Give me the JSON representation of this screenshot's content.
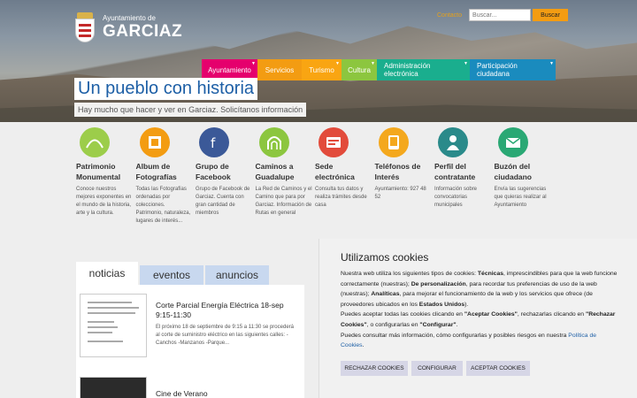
{
  "header": {
    "logo_small": "Ayuntamiento de",
    "logo_big": "GARCIAZ",
    "contact": "Contacto",
    "search_placeholder": "Buscar...",
    "search_button": "Buscar"
  },
  "nav": [
    {
      "label": "Ayuntamiento",
      "color": "#e5006d",
      "dropdown": true
    },
    {
      "label": "Servicios",
      "color": "#f39c12",
      "dropdown": false
    },
    {
      "label": "Turismo",
      "color": "#f9a512",
      "dropdown": true
    },
    {
      "label": "Cultura",
      "color": "#8cc63f",
      "dropdown": true
    },
    {
      "label": "Administración electrónica",
      "color": "#1aae8e",
      "dropdown": true
    },
    {
      "label": "Participación ciudadana",
      "color": "#1a8bbe",
      "dropdown": true
    }
  ],
  "hero": {
    "slogan": "Un pueblo con historia",
    "sub": "Hay mucho que hacer y ver en Garciaz. Solicítanos información"
  },
  "features": [
    {
      "title": "Patrimonio Monumental",
      "desc": "Conoce nuestros mejores exponentes en el mundo de la historia, arte y la cultura.",
      "color": "#9ccd4a",
      "icon": "monument-icon"
    },
    {
      "title": "Album de Fotografías",
      "desc": "Todas las Fotografías ordenadas por colecciones. Patrimonio, naturaleza, lugares de interés...",
      "color": "#f39c12",
      "icon": "photo-album-icon"
    },
    {
      "title": "Grupo de Facebook",
      "desc": "Grupo de Facebook de Garciaz. Cuenta con gran cantidad de miembros",
      "color": "#3b5998",
      "icon": "facebook-group-icon"
    },
    {
      "title": "Caminos a Guadalupe",
      "desc": "La Red de Caminos y el Camino que para por Garciaz. Información de Rutas en general",
      "color": "#8cc63f",
      "icon": "arch-icon"
    },
    {
      "title": "Sede electrónica",
      "desc": "Consulta tus datos y realiza trámites desde casa",
      "color": "#e24b3b",
      "icon": "e-office-icon"
    },
    {
      "title": "Teléfonos de Interés",
      "desc": "Ayuntamiento: 927 48 52",
      "color": "#f4a81d",
      "icon": "phone-icon"
    },
    {
      "title": "Perfil del contratante",
      "desc": "Información sobre convocatorias municipales",
      "color": "#2a8a8a",
      "icon": "profile-icon"
    },
    {
      "title": "Buzón del ciudadano",
      "desc": "Envía las sugerencias que quieras realizar al Ayuntamiento",
      "color": "#2aa874",
      "icon": "mailbox-icon"
    }
  ],
  "tabs": [
    "noticias",
    "eventos",
    "anuncios"
  ],
  "news": [
    {
      "title": "Corte Parcial Energía Eléctrica 18-sep 9:15-11:30",
      "text": "El próximo 18 de septiembre de 9:15 a 11:30 se procederá al corte de suministro eléctrico en las siguientes calles: -Canchos -Manzanos -Parque..."
    },
    {
      "title": "Cine de Verano",
      "text": ""
    }
  ],
  "cookie": {
    "title": "Utilizamos cookies",
    "text_html": "Nuestra web utiliza los siguientes tipos de cookies: <b>Técnicas</b>, imprescindibles para que la web funcione correctamente (nuestras); <b>De personalización</b>, para recordar tus preferencias de uso de la web (nuestras); <b>Analíticas</b>, para mejorar el funcionamiento de la web y los servicios que ofrece (de proveedores ubicados en los <b>Estados Unidos</b>).<br>Puedes aceptar todas las cookies clicando en <b>\"Aceptar Cookies\"</b>, rechazarlas clicando en <b>\"Rechazar Cookies\"</b>, o configurarlas en <b>\"Configurar\"</b>.<br>Puedes consultar más información, cómo configurarlas y posibles riesgos en nuestra",
    "policy_link": "Política de Cookies",
    "btn_reject": "RECHAZAR COOKIES",
    "btn_config": "CONFIGURAR",
    "btn_accept": "ACEPTAR COOKIES"
  }
}
